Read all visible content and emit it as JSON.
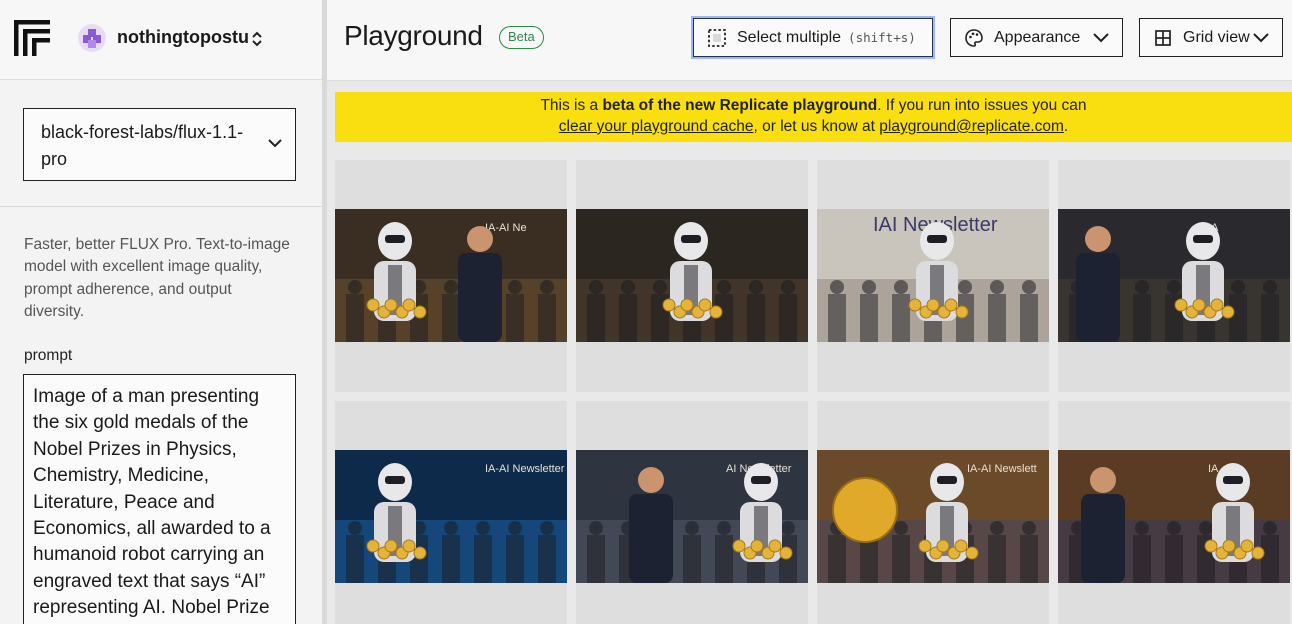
{
  "org": {
    "name": "nothingtopostu"
  },
  "model": {
    "name": "black-forest-labs/flux-1.1-pro",
    "description": "Faster, better FLUX Pro. Text-to-image model with excellent image quality, prompt adherence, and output diversity."
  },
  "prompt": {
    "label": "prompt",
    "value": "Image of a man presenting the six gold medals of the Nobel Prizes in Physics, Chemistry, Medicine, Literature, Peace and Economics, all awarded to a humanoid robot carrying an engraved text that says “AI” representing AI. Nobel Prize"
  },
  "header": {
    "title": "Playground",
    "badge": "Beta",
    "select_multiple": {
      "label": "Select multiple",
      "shortcut": "(shift+s)"
    },
    "appearance": {
      "label": "Appearance"
    },
    "view": {
      "label": "Grid view"
    }
  },
  "banner": {
    "text_1": "This is a ",
    "bold": "beta of the new Replicate playground",
    "text_2": ". If you run into issues you can",
    "link_1": "clear your playground cache",
    "text_3": ", or let us know at ",
    "link_2": "playground@replicate.com",
    "text_4": "."
  },
  "images": [
    {
      "scene": "robot-receiving-envelope",
      "sign": "IA-AI Ne"
    },
    {
      "scene": "robot-holding-medals-crowd",
      "sign": ""
    },
    {
      "scene": "robot-at-podium",
      "sign": "IAI Newsletter"
    },
    {
      "scene": "man-handing-medals-to-robot",
      "sign": "IA"
    },
    {
      "scene": "robot-blue-background",
      "sign": "IA-AI Newsletter"
    },
    {
      "scene": "man-presenting-medals-to-robot",
      "sign": "AI Newsletter"
    },
    {
      "scene": "robot-with-giant-medal",
      "sign": "IA-AI Newslett"
    },
    {
      "scene": "robot-receiving-medals-hall",
      "sign": "IA"
    }
  ],
  "colors": {
    "banner": "#fadf10",
    "badge": "#2d8a4a",
    "focus_ring": "#9fb6f5",
    "tile": "#dedede"
  },
  "icons": {
    "logo": "replicate-logo",
    "org_avatar": "avatar-icon",
    "org_switch": "chevron-up-down-icon",
    "select_multiple": "dashed-selection-icon",
    "appearance": "palette-icon",
    "grid_view": "grid-icon",
    "dropdown": "chevron-down-icon"
  }
}
